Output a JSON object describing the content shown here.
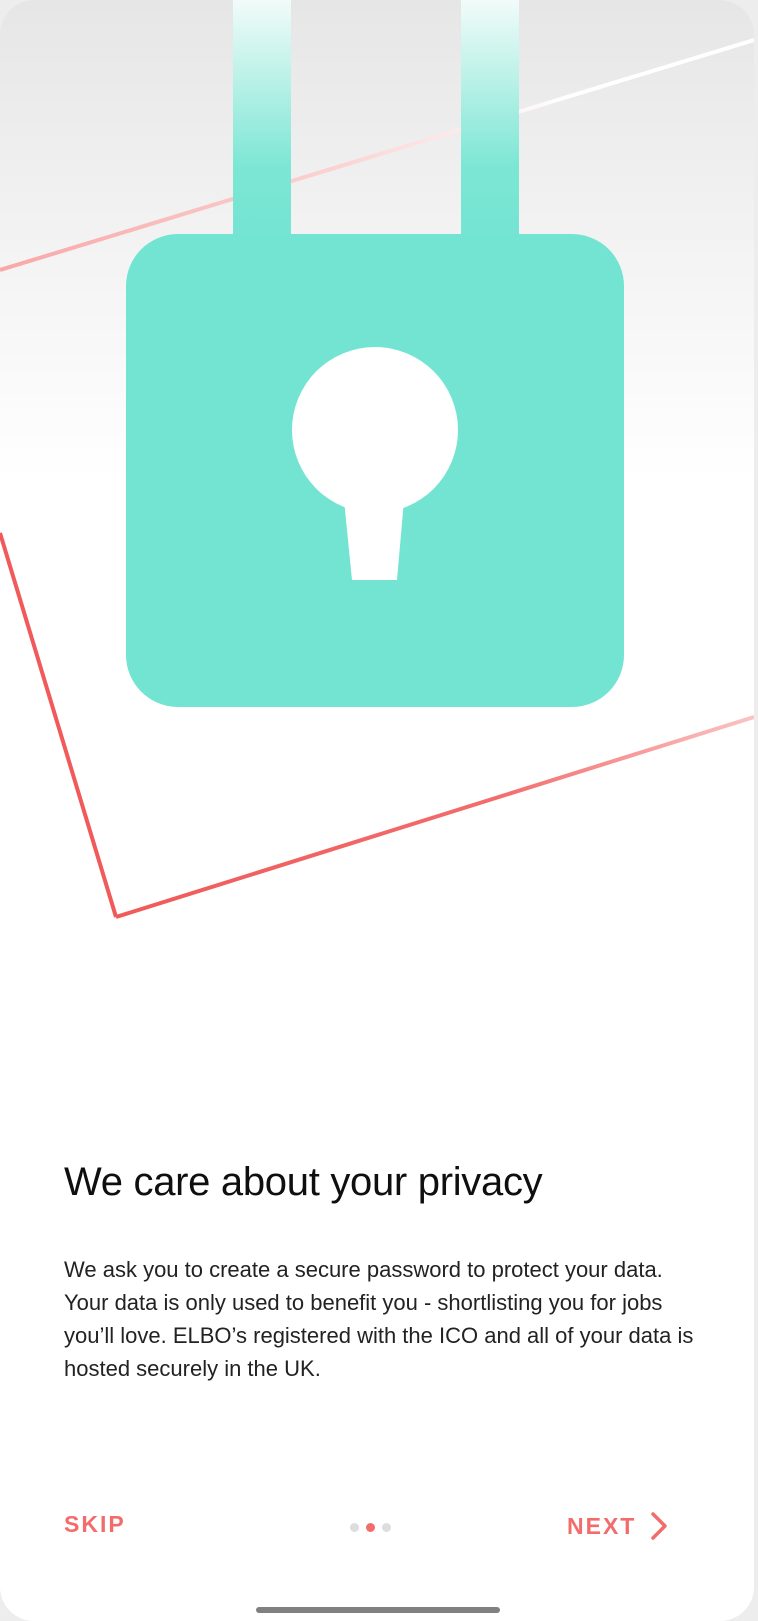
{
  "onboarding": {
    "title": "We care about your privacy",
    "body": "We ask you to create a secure password to protect your data. Your data is only used to benefit you - shortlisting you for jobs you’ll love. ELBO’s registered with the ICO and all of your data is hosted securely in the UK.",
    "illustration_icon": "padlock-icon",
    "page_indicator": {
      "total_pages": 3,
      "current_page": 2
    }
  },
  "footer": {
    "skip_label": "SKIP",
    "next_label": "NEXT",
    "next_icon": "chevron-right-icon"
  },
  "colors": {
    "accent": "#f36c6c",
    "lock": "#74e4d2",
    "title_text": "#0f0f0f",
    "body_text": "#222222",
    "dot_inactive": "#dddddd"
  }
}
